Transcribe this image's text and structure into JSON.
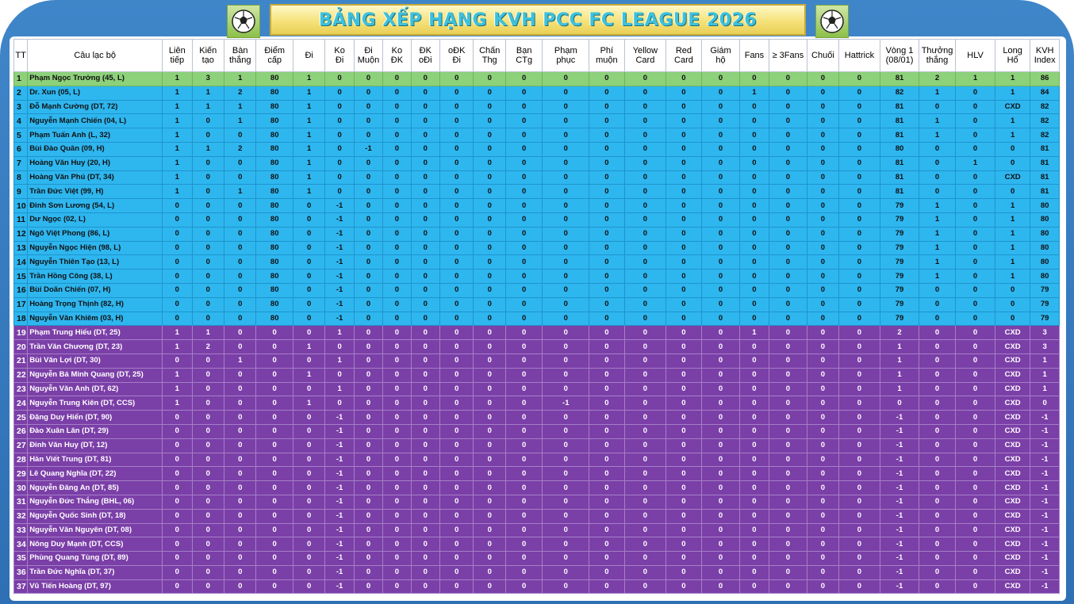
{
  "title": "BẢNG XẾP HẠNG KVH PCC FC LEAGUE 2026",
  "icons": {
    "left": "soccer-ball-icon",
    "right": "soccer-ball-icon"
  },
  "colors": {
    "top": "#8dd17a",
    "blue": "#2eb6ef",
    "purple": "#7b3fa8",
    "frame": "#3f86c9",
    "title_bg": "#f5e27a"
  },
  "columns": [
    {
      "l1": "TT",
      "l2": ""
    },
    {
      "l1": "Câu lạc bộ",
      "l2": ""
    },
    {
      "l1": "Liên",
      "l2": "tiếp"
    },
    {
      "l1": "Kiến",
      "l2": "tạo"
    },
    {
      "l1": "Bàn",
      "l2": "thắng"
    },
    {
      "l1": "Điểm",
      "l2": "cấp"
    },
    {
      "l1": "Đi",
      "l2": ""
    },
    {
      "l1": "Ko",
      "l2": "Đi"
    },
    {
      "l1": "Đi",
      "l2": "Muộn"
    },
    {
      "l1": "Ko",
      "l2": "ĐK"
    },
    {
      "l1": "ĐK",
      "l2": "oĐi"
    },
    {
      "l1": "oĐK",
      "l2": "Đi"
    },
    {
      "l1": "Chấn",
      "l2": "Thg"
    },
    {
      "l1": "Bạn",
      "l2": "CTg"
    },
    {
      "l1": "Phạm",
      "l2": "phục"
    },
    {
      "l1": "Phí",
      "l2": "muộn"
    },
    {
      "l1": "Yellow",
      "l2": "Card"
    },
    {
      "l1": "Red",
      "l2": "Card"
    },
    {
      "l1": "Giám",
      "l2": "hộ"
    },
    {
      "l1": "Fans",
      "l2": ""
    },
    {
      "l1": "≥ 3Fans",
      "l2": ""
    },
    {
      "l1": "Chuối",
      "l2": ""
    },
    {
      "l1": "Hattrick",
      "l2": ""
    },
    {
      "l1": "Vòng 1",
      "l2": "(08/01)"
    },
    {
      "l1": "Thưởng",
      "l2": "thắng"
    },
    {
      "l1": "HLV",
      "l2": ""
    },
    {
      "l1": "Long",
      "l2": "Hổ"
    },
    {
      "l1": "KVH",
      "l2": "Index"
    }
  ],
  "rows": [
    [
      "g",
      "1",
      "Phạm Ngọc Trưởng (45, L)",
      "1",
      "3",
      "1",
      "80",
      "1",
      "0",
      "0",
      "0",
      "0",
      "0",
      "0",
      "0",
      "0",
      "0",
      "0",
      "0",
      "0",
      "0",
      "0",
      "0",
      "0",
      "81",
      "2",
      "1",
      "1",
      "86"
    ],
    [
      "b",
      "2",
      "Dr. Xun (05, L)",
      "1",
      "1",
      "2",
      "80",
      "1",
      "0",
      "0",
      "0",
      "0",
      "0",
      "0",
      "0",
      "0",
      "0",
      "0",
      "0",
      "0",
      "1",
      "0",
      "0",
      "0",
      "82",
      "1",
      "0",
      "1",
      "84"
    ],
    [
      "b",
      "3",
      "Đỗ Mạnh Cường (DT, 72)",
      "1",
      "1",
      "1",
      "80",
      "1",
      "0",
      "0",
      "0",
      "0",
      "0",
      "0",
      "0",
      "0",
      "0",
      "0",
      "0",
      "0",
      "0",
      "0",
      "0",
      "0",
      "81",
      "0",
      "0",
      "CXD",
      "82"
    ],
    [
      "b",
      "4",
      "Nguyễn Mạnh Chiến (04, L)",
      "1",
      "0",
      "1",
      "80",
      "1",
      "0",
      "0",
      "0",
      "0",
      "0",
      "0",
      "0",
      "0",
      "0",
      "0",
      "0",
      "0",
      "0",
      "0",
      "0",
      "0",
      "81",
      "1",
      "0",
      "1",
      "82"
    ],
    [
      "b",
      "5",
      "Phạm Tuấn Anh (L, 32)",
      "1",
      "0",
      "0",
      "80",
      "1",
      "0",
      "0",
      "0",
      "0",
      "0",
      "0",
      "0",
      "0",
      "0",
      "0",
      "0",
      "0",
      "0",
      "0",
      "0",
      "0",
      "81",
      "1",
      "0",
      "1",
      "82"
    ],
    [
      "b",
      "6",
      "Bùi Đào Quân (09, H)",
      "1",
      "1",
      "2",
      "80",
      "1",
      "0",
      "-1",
      "0",
      "0",
      "0",
      "0",
      "0",
      "0",
      "0",
      "0",
      "0",
      "0",
      "0",
      "0",
      "0",
      "0",
      "80",
      "0",
      "0",
      "0",
      "81"
    ],
    [
      "b",
      "7",
      "Hoàng Văn Huy (20, H)",
      "1",
      "0",
      "0",
      "80",
      "1",
      "0",
      "0",
      "0",
      "0",
      "0",
      "0",
      "0",
      "0",
      "0",
      "0",
      "0",
      "0",
      "0",
      "0",
      "0",
      "0",
      "81",
      "0",
      "1",
      "0",
      "81"
    ],
    [
      "b",
      "8",
      "Hoàng Văn Phú (DT, 34)",
      "1",
      "0",
      "0",
      "80",
      "1",
      "0",
      "0",
      "0",
      "0",
      "0",
      "0",
      "0",
      "0",
      "0",
      "0",
      "0",
      "0",
      "0",
      "0",
      "0",
      "0",
      "81",
      "0",
      "0",
      "CXD",
      "81"
    ],
    [
      "b",
      "9",
      "Trần Đức Việt (99, H)",
      "1",
      "0",
      "1",
      "80",
      "1",
      "0",
      "0",
      "0",
      "0",
      "0",
      "0",
      "0",
      "0",
      "0",
      "0",
      "0",
      "0",
      "0",
      "0",
      "0",
      "0",
      "81",
      "0",
      "0",
      "0",
      "81"
    ],
    [
      "b",
      "10",
      "Đinh Sơn Lương (54, L)",
      "0",
      "0",
      "0",
      "80",
      "0",
      "-1",
      "0",
      "0",
      "0",
      "0",
      "0",
      "0",
      "0",
      "0",
      "0",
      "0",
      "0",
      "0",
      "0",
      "0",
      "0",
      "79",
      "1",
      "0",
      "1",
      "80"
    ],
    [
      "b",
      "11",
      "Dư Ngọc (02, L)",
      "0",
      "0",
      "0",
      "80",
      "0",
      "-1",
      "0",
      "0",
      "0",
      "0",
      "0",
      "0",
      "0",
      "0",
      "0",
      "0",
      "0",
      "0",
      "0",
      "0",
      "0",
      "79",
      "1",
      "0",
      "1",
      "80"
    ],
    [
      "b",
      "12",
      "Ngô Việt Phong (86, L)",
      "0",
      "0",
      "0",
      "80",
      "0",
      "-1",
      "0",
      "0",
      "0",
      "0",
      "0",
      "0",
      "0",
      "0",
      "0",
      "0",
      "0",
      "0",
      "0",
      "0",
      "0",
      "79",
      "1",
      "0",
      "1",
      "80"
    ],
    [
      "b",
      "13",
      "Nguyễn Ngọc Hiện (98, L)",
      "0",
      "0",
      "0",
      "80",
      "0",
      "-1",
      "0",
      "0",
      "0",
      "0",
      "0",
      "0",
      "0",
      "0",
      "0",
      "0",
      "0",
      "0",
      "0",
      "0",
      "0",
      "79",
      "1",
      "0",
      "1",
      "80"
    ],
    [
      "b",
      "14",
      "Nguyễn Thiên Tạo (13, L)",
      "0",
      "0",
      "0",
      "80",
      "0",
      "-1",
      "0",
      "0",
      "0",
      "0",
      "0",
      "0",
      "0",
      "0",
      "0",
      "0",
      "0",
      "0",
      "0",
      "0",
      "0",
      "79",
      "1",
      "0",
      "1",
      "80"
    ],
    [
      "b",
      "15",
      "Trần Hồng Công (38, L)",
      "0",
      "0",
      "0",
      "80",
      "0",
      "-1",
      "0",
      "0",
      "0",
      "0",
      "0",
      "0",
      "0",
      "0",
      "0",
      "0",
      "0",
      "0",
      "0",
      "0",
      "0",
      "79",
      "1",
      "0",
      "1",
      "80"
    ],
    [
      "b",
      "16",
      "Bùi Doãn Chiến (07, H)",
      "0",
      "0",
      "0",
      "80",
      "0",
      "-1",
      "0",
      "0",
      "0",
      "0",
      "0",
      "0",
      "0",
      "0",
      "0",
      "0",
      "0",
      "0",
      "0",
      "0",
      "0",
      "79",
      "0",
      "0",
      "0",
      "79"
    ],
    [
      "b",
      "17",
      "Hoàng Trọng Thịnh (82, H)",
      "0",
      "0",
      "0",
      "80",
      "0",
      "-1",
      "0",
      "0",
      "0",
      "0",
      "0",
      "0",
      "0",
      "0",
      "0",
      "0",
      "0",
      "0",
      "0",
      "0",
      "0",
      "79",
      "0",
      "0",
      "0",
      "79"
    ],
    [
      "b",
      "18",
      "Nguyễn Văn Khiêm (03, H)",
      "0",
      "0",
      "0",
      "80",
      "0",
      "-1",
      "0",
      "0",
      "0",
      "0",
      "0",
      "0",
      "0",
      "0",
      "0",
      "0",
      "0",
      "0",
      "0",
      "0",
      "0",
      "79",
      "0",
      "0",
      "0",
      "79"
    ],
    [
      "p",
      "19",
      "Phạm Trung Hiếu (DT, 25)",
      "1",
      "1",
      "0",
      "0",
      "0",
      "1",
      "0",
      "0",
      "0",
      "0",
      "0",
      "0",
      "0",
      "0",
      "0",
      "0",
      "0",
      "1",
      "0",
      "0",
      "0",
      "2",
      "0",
      "0",
      "CXD",
      "3"
    ],
    [
      "p",
      "20",
      "Trần Văn Chương (DT, 23)",
      "1",
      "2",
      "0",
      "0",
      "1",
      "0",
      "0",
      "0",
      "0",
      "0",
      "0",
      "0",
      "0",
      "0",
      "0",
      "0",
      "0",
      "0",
      "0",
      "0",
      "0",
      "1",
      "0",
      "0",
      "CXD",
      "3"
    ],
    [
      "p",
      "21",
      "Bùi Văn Lợi (DT, 30)",
      "0",
      "0",
      "1",
      "0",
      "0",
      "1",
      "0",
      "0",
      "0",
      "0",
      "0",
      "0",
      "0",
      "0",
      "0",
      "0",
      "0",
      "0",
      "0",
      "0",
      "0",
      "1",
      "0",
      "0",
      "CXD",
      "1"
    ],
    [
      "p",
      "22",
      "Nguyễn Bá Minh Quang (DT, 25)",
      "1",
      "0",
      "0",
      "0",
      "1",
      "0",
      "0",
      "0",
      "0",
      "0",
      "0",
      "0",
      "0",
      "0",
      "0",
      "0",
      "0",
      "0",
      "0",
      "0",
      "0",
      "1",
      "0",
      "0",
      "CXD",
      "1"
    ],
    [
      "p",
      "23",
      "Nguyễn Văn Anh (DT, 62)",
      "1",
      "0",
      "0",
      "0",
      "0",
      "1",
      "0",
      "0",
      "0",
      "0",
      "0",
      "0",
      "0",
      "0",
      "0",
      "0",
      "0",
      "0",
      "0",
      "0",
      "0",
      "1",
      "0",
      "0",
      "CXD",
      "1"
    ],
    [
      "p",
      "24",
      "Nguyễn Trung Kiên (DT, CCS)",
      "1",
      "0",
      "0",
      "0",
      "1",
      "0",
      "0",
      "0",
      "0",
      "0",
      "0",
      "0",
      "-1",
      "0",
      "0",
      "0",
      "0",
      "0",
      "0",
      "0",
      "0",
      "0",
      "0",
      "0",
      "CXD",
      "0"
    ],
    [
      "p",
      "25",
      "Đặng Duy Hiển (DT, 90)",
      "0",
      "0",
      "0",
      "0",
      "0",
      "-1",
      "0",
      "0",
      "0",
      "0",
      "0",
      "0",
      "0",
      "0",
      "0",
      "0",
      "0",
      "0",
      "0",
      "0",
      "0",
      "-1",
      "0",
      "0",
      "CXD",
      "-1"
    ],
    [
      "p",
      "26",
      "Đào Xuân Lân (DT, 29)",
      "0",
      "0",
      "0",
      "0",
      "0",
      "-1",
      "0",
      "0",
      "0",
      "0",
      "0",
      "0",
      "0",
      "0",
      "0",
      "0",
      "0",
      "0",
      "0",
      "0",
      "0",
      "-1",
      "0",
      "0",
      "CXD",
      "-1"
    ],
    [
      "p",
      "27",
      "Đinh Văn Huy (DT, 12)",
      "0",
      "0",
      "0",
      "0",
      "0",
      "-1",
      "0",
      "0",
      "0",
      "0",
      "0",
      "0",
      "0",
      "0",
      "0",
      "0",
      "0",
      "0",
      "0",
      "0",
      "0",
      "-1",
      "0",
      "0",
      "CXD",
      "-1"
    ],
    [
      "p",
      "28",
      "Hàn Viết Trung (DT, 81)",
      "0",
      "0",
      "0",
      "0",
      "0",
      "-1",
      "0",
      "0",
      "0",
      "0",
      "0",
      "0",
      "0",
      "0",
      "0",
      "0",
      "0",
      "0",
      "0",
      "0",
      "0",
      "-1",
      "0",
      "0",
      "CXD",
      "-1"
    ],
    [
      "p",
      "29",
      "Lê Quang Nghĩa (DT, 22)",
      "0",
      "0",
      "0",
      "0",
      "0",
      "-1",
      "0",
      "0",
      "0",
      "0",
      "0",
      "0",
      "0",
      "0",
      "0",
      "0",
      "0",
      "0",
      "0",
      "0",
      "0",
      "-1",
      "0",
      "0",
      "CXD",
      "-1"
    ],
    [
      "p",
      "30",
      "Nguyễn Đăng An (DT, 85)",
      "0",
      "0",
      "0",
      "0",
      "0",
      "-1",
      "0",
      "0",
      "0",
      "0",
      "0",
      "0",
      "0",
      "0",
      "0",
      "0",
      "0",
      "0",
      "0",
      "0",
      "0",
      "-1",
      "0",
      "0",
      "CXD",
      "-1"
    ],
    [
      "p",
      "31",
      "Nguyễn Đức Thắng (BHL, 06)",
      "0",
      "0",
      "0",
      "0",
      "0",
      "-1",
      "0",
      "0",
      "0",
      "0",
      "0",
      "0",
      "0",
      "0",
      "0",
      "0",
      "0",
      "0",
      "0",
      "0",
      "0",
      "-1",
      "0",
      "0",
      "CXD",
      "-1"
    ],
    [
      "p",
      "32",
      "Nguyễn Quốc Sinh (DT, 18)",
      "0",
      "0",
      "0",
      "0",
      "0",
      "-1",
      "0",
      "0",
      "0",
      "0",
      "0",
      "0",
      "0",
      "0",
      "0",
      "0",
      "0",
      "0",
      "0",
      "0",
      "0",
      "-1",
      "0",
      "0",
      "CXD",
      "-1"
    ],
    [
      "p",
      "33",
      "Nguyễn Văn Nguyên (DT, 08)",
      "0",
      "0",
      "0",
      "0",
      "0",
      "-1",
      "0",
      "0",
      "0",
      "0",
      "0",
      "0",
      "0",
      "0",
      "0",
      "0",
      "0",
      "0",
      "0",
      "0",
      "0",
      "-1",
      "0",
      "0",
      "CXD",
      "-1"
    ],
    [
      "p",
      "34",
      "Nông Duy Mạnh (DT, CCS)",
      "0",
      "0",
      "0",
      "0",
      "0",
      "-1",
      "0",
      "0",
      "0",
      "0",
      "0",
      "0",
      "0",
      "0",
      "0",
      "0",
      "0",
      "0",
      "0",
      "0",
      "0",
      "-1",
      "0",
      "0",
      "CXD",
      "-1"
    ],
    [
      "p",
      "35",
      "Phùng Quang Tùng (DT, 89)",
      "0",
      "0",
      "0",
      "0",
      "0",
      "-1",
      "0",
      "0",
      "0",
      "0",
      "0",
      "0",
      "0",
      "0",
      "0",
      "0",
      "0",
      "0",
      "0",
      "0",
      "0",
      "-1",
      "0",
      "0",
      "CXD",
      "-1"
    ],
    [
      "p",
      "36",
      "Trần Đức Nghĩa (DT, 37)",
      "0",
      "0",
      "0",
      "0",
      "0",
      "-1",
      "0",
      "0",
      "0",
      "0",
      "0",
      "0",
      "0",
      "0",
      "0",
      "0",
      "0",
      "0",
      "0",
      "0",
      "0",
      "-1",
      "0",
      "0",
      "CXD",
      "-1"
    ],
    [
      "p",
      "37",
      "Vũ Tiến Hoàng (DT, 97)",
      "0",
      "0",
      "0",
      "0",
      "0",
      "-1",
      "0",
      "0",
      "0",
      "0",
      "0",
      "0",
      "0",
      "0",
      "0",
      "0",
      "0",
      "0",
      "0",
      "0",
      "0",
      "-1",
      "0",
      "0",
      "CXD",
      "-1"
    ]
  ]
}
